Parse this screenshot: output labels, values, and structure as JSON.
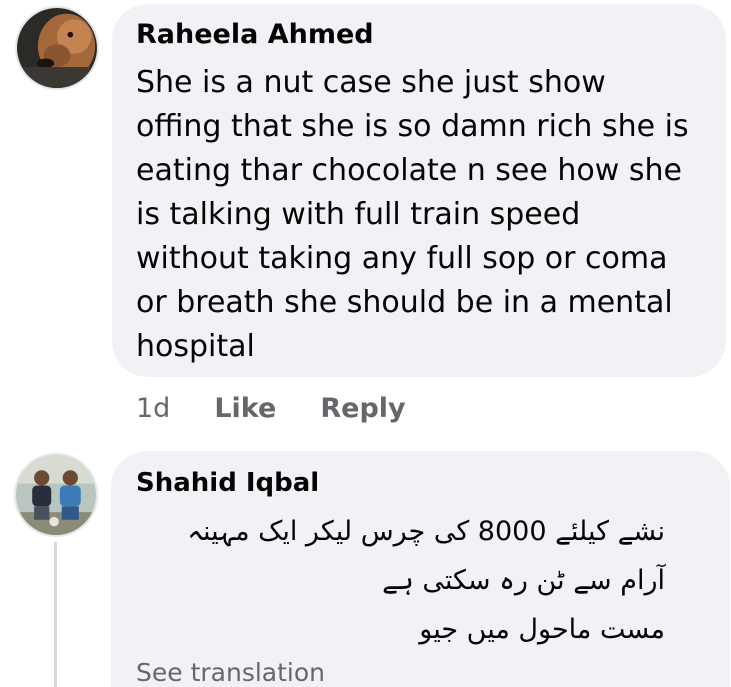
{
  "comments": [
    {
      "author": "Raheela Ahmed",
      "text": "She is a nut case she just show\noffing that she is so damn  rich she is\neating thar chocolate  n see how she\nis talking with full train speed\nwithout  taking any full sop or coma\nor breath she should be in a mental\nhospital",
      "time": "1d",
      "like_label": "Like",
      "reply_label": "Reply"
    },
    {
      "author": "Shahid Iqbal",
      "text": "نشے کیلئے 8000 کی چرس لیکر ایک مہینہ\nآرام سے ٹن رہ سکتی ہے\nمست ماحول میں جیو",
      "see_translation": "See translation"
    }
  ]
}
